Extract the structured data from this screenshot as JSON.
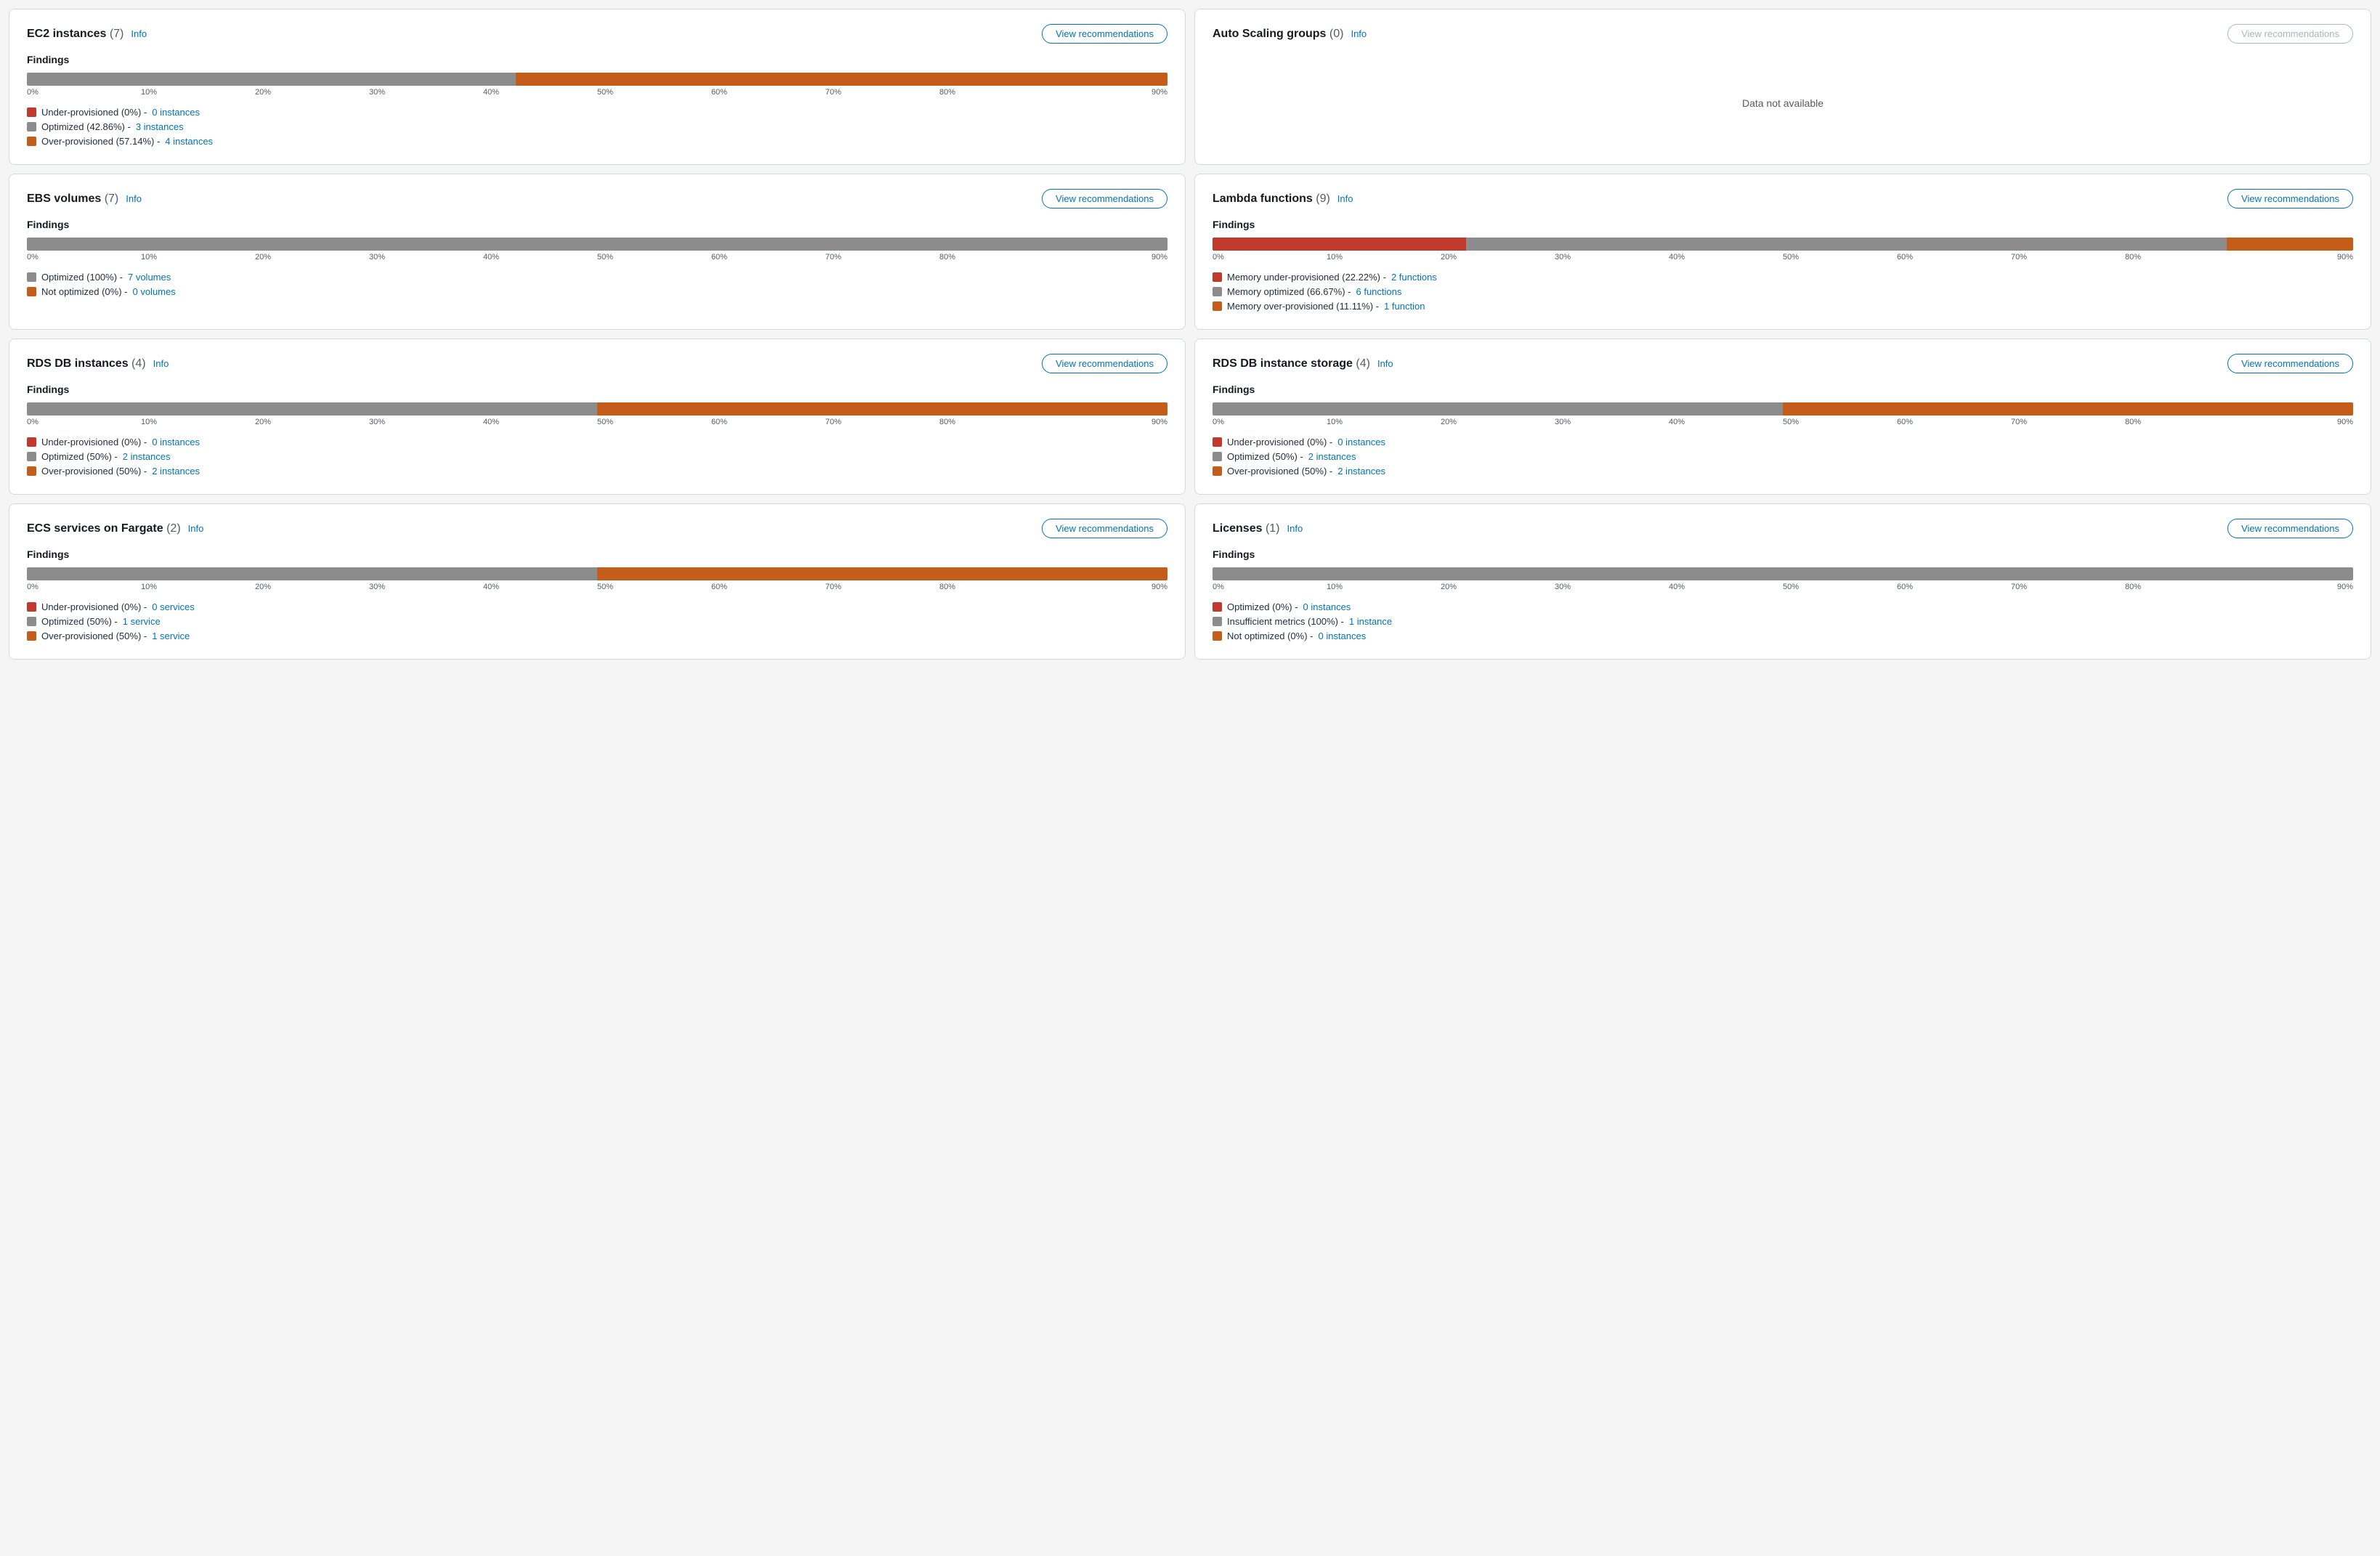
{
  "cards": [
    {
      "id": "ec2",
      "title": "EC2 instances",
      "count": 7,
      "hasData": true,
      "btnDisabled": false,
      "btnLabel": "View recommendations",
      "findingsLabel": "Findings",
      "segments": [
        {
          "color": "#8c8c8c",
          "pct": 42.86,
          "label": "optimized"
        },
        {
          "color": "#c45c1a",
          "pct": 57.14,
          "label": "over"
        }
      ],
      "legend": [
        {
          "color": "#c0392b",
          "text": "Under-provisioned (0%) -",
          "linkText": "0 instances",
          "linkHref": "#"
        },
        {
          "color": "#8c8c8c",
          "text": "Optimized (42.86%) -",
          "linkText": "3 instances",
          "linkHref": "#"
        },
        {
          "color": "#c45c1a",
          "text": "Over-provisioned (57.14%) -",
          "linkText": "4 instances",
          "linkHref": "#"
        }
      ]
    },
    {
      "id": "asg",
      "title": "Auto Scaling groups",
      "count": 0,
      "hasData": false,
      "btnDisabled": true,
      "btnLabel": "View recommendations",
      "noDataText": "Data not available",
      "segments": [],
      "legend": []
    },
    {
      "id": "ebs",
      "title": "EBS volumes",
      "count": 7,
      "hasData": true,
      "btnDisabled": false,
      "btnLabel": "View recommendations",
      "findingsLabel": "Findings",
      "segments": [
        {
          "color": "#8c8c8c",
          "pct": 100,
          "label": "optimized"
        }
      ],
      "legend": [
        {
          "color": "#8c8c8c",
          "text": "Optimized (100%) -",
          "linkText": "7 volumes",
          "linkHref": "#"
        },
        {
          "color": "#c45c1a",
          "text": "Not optimized (0%) -",
          "linkText": "0 volumes",
          "linkHref": "#"
        }
      ]
    },
    {
      "id": "lambda",
      "title": "Lambda functions",
      "count": 9,
      "hasData": true,
      "btnDisabled": false,
      "btnLabel": "View recommendations",
      "findingsLabel": "Findings",
      "segments": [
        {
          "color": "#c0392b",
          "pct": 22.22,
          "label": "under"
        },
        {
          "color": "#8c8c8c",
          "pct": 66.67,
          "label": "optimized"
        },
        {
          "color": "#c45c1a",
          "pct": 11.11,
          "label": "over"
        }
      ],
      "legend": [
        {
          "color": "#c0392b",
          "text": "Memory under-provisioned (22.22%) -",
          "linkText": "2 functions",
          "linkHref": "#"
        },
        {
          "color": "#8c8c8c",
          "text": "Memory optimized (66.67%) -",
          "linkText": "6 functions",
          "linkHref": "#"
        },
        {
          "color": "#c45c1a",
          "text": "Memory over-provisioned (11.11%) -",
          "linkText": "1 function",
          "linkHref": "#"
        }
      ]
    },
    {
      "id": "rds",
      "title": "RDS DB instances",
      "count": 4,
      "hasData": true,
      "btnDisabled": false,
      "btnLabel": "View recommendations",
      "findingsLabel": "Findings",
      "segments": [
        {
          "color": "#8c8c8c",
          "pct": 50,
          "label": "optimized"
        },
        {
          "color": "#c45c1a",
          "pct": 50,
          "label": "over"
        }
      ],
      "legend": [
        {
          "color": "#c0392b",
          "text": "Under-provisioned (0%) -",
          "linkText": "0 instances",
          "linkHref": "#"
        },
        {
          "color": "#8c8c8c",
          "text": "Optimized (50%) -",
          "linkText": "2 instances",
          "linkHref": "#"
        },
        {
          "color": "#c45c1a",
          "text": "Over-provisioned (50%) -",
          "linkText": "2 instances",
          "linkHref": "#"
        }
      ]
    },
    {
      "id": "rds-storage",
      "title": "RDS DB instance storage",
      "count": 4,
      "hasData": true,
      "btnDisabled": false,
      "btnLabel": "View recommendations",
      "findingsLabel": "Findings",
      "segments": [
        {
          "color": "#8c8c8c",
          "pct": 50,
          "label": "optimized"
        },
        {
          "color": "#c45c1a",
          "pct": 50,
          "label": "over"
        }
      ],
      "legend": [
        {
          "color": "#c0392b",
          "text": "Under-provisioned (0%) -",
          "linkText": "0 instances",
          "linkHref": "#"
        },
        {
          "color": "#8c8c8c",
          "text": "Optimized (50%) -",
          "linkText": "2 instances",
          "linkHref": "#"
        },
        {
          "color": "#c45c1a",
          "text": "Over-provisioned (50%) -",
          "linkText": "2 instances",
          "linkHref": "#"
        }
      ]
    },
    {
      "id": "ecs",
      "title": "ECS services on Fargate",
      "count": 2,
      "hasData": true,
      "btnDisabled": false,
      "btnLabel": "View recommendations",
      "findingsLabel": "Findings",
      "segments": [
        {
          "color": "#8c8c8c",
          "pct": 50,
          "label": "optimized"
        },
        {
          "color": "#c45c1a",
          "pct": 50,
          "label": "over"
        }
      ],
      "legend": [
        {
          "color": "#c0392b",
          "text": "Under-provisioned (0%) -",
          "linkText": "0 services",
          "linkHref": "#"
        },
        {
          "color": "#8c8c8c",
          "text": "Optimized (50%) -",
          "linkText": "1 service",
          "linkHref": "#"
        },
        {
          "color": "#c45c1a",
          "text": "Over-provisioned (50%) -",
          "linkText": "1 service",
          "linkHref": "#"
        }
      ]
    },
    {
      "id": "licenses",
      "title": "Licenses",
      "count": 1,
      "hasData": true,
      "btnDisabled": false,
      "btnLabel": "View recommendations",
      "findingsLabel": "Findings",
      "segments": [
        {
          "color": "#8c8c8c",
          "pct": 100,
          "label": "optimized"
        }
      ],
      "legend": [
        {
          "color": "#c0392b",
          "text": "Optimized (0%) -",
          "linkText": "0 instances",
          "linkHref": "#"
        },
        {
          "color": "#8c8c8c",
          "text": "Insufficient metrics (100%) -",
          "linkText": "1 instance",
          "linkHref": "#"
        },
        {
          "color": "#c45c1a",
          "text": "Not optimized (0%) -",
          "linkText": "0 instances",
          "linkHref": "#"
        }
      ]
    }
  ],
  "pctLabels": [
    "0%",
    "10%",
    "20%",
    "30%",
    "40%",
    "50%",
    "60%",
    "70%",
    "80%",
    "90%"
  ]
}
